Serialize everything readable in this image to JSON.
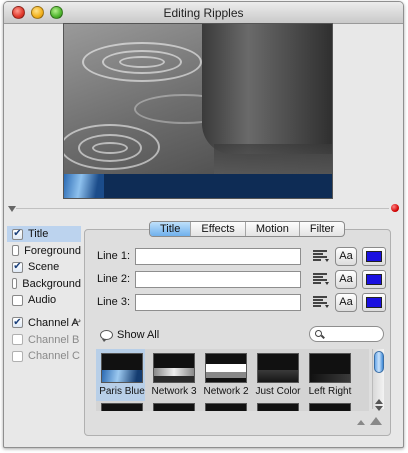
{
  "window": {
    "title": "Editing Ripples"
  },
  "sidebar": {
    "items": [
      {
        "label": "Title",
        "checked": true,
        "selected": true,
        "disabled": false
      },
      {
        "label": "Foreground",
        "checked": false,
        "selected": false,
        "disabled": false
      },
      {
        "label": "Scene",
        "checked": true,
        "selected": false,
        "disabled": false
      },
      {
        "label": "Background",
        "checked": false,
        "selected": false,
        "disabled": false
      },
      {
        "label": "Audio",
        "checked": false,
        "selected": false,
        "disabled": false
      }
    ],
    "channels": [
      {
        "label": "Channel A",
        "checked": true,
        "disabled": false
      },
      {
        "label": "Channel B",
        "checked": false,
        "disabled": true
      },
      {
        "label": "Channel C",
        "checked": false,
        "disabled": true
      }
    ]
  },
  "tabs": [
    {
      "label": "Title",
      "active": true
    },
    {
      "label": "Effects",
      "active": false
    },
    {
      "label": "Motion",
      "active": false
    },
    {
      "label": "Filter",
      "active": false
    }
  ],
  "lines": [
    {
      "label": "Line 1:",
      "value": "",
      "font_button": "Aa",
      "color": "#1a10e0"
    },
    {
      "label": "Line 2:",
      "value": "",
      "font_button": "Aa",
      "color": "#1a10e0"
    },
    {
      "label": "Line 3:",
      "value": "",
      "font_button": "Aa",
      "color": "#1a10e0"
    }
  ],
  "show_all": {
    "label": "Show All"
  },
  "search": {
    "value": ""
  },
  "templates": [
    {
      "name": "Paris Blue",
      "selected": true
    },
    {
      "name": "Network 3",
      "selected": false
    },
    {
      "name": "Network 2",
      "selected": false
    },
    {
      "name": "Just Color",
      "selected": false
    },
    {
      "name": "Left Right",
      "selected": false
    }
  ],
  "icons": {
    "disclosure": "disclosure-triangle-icon",
    "status": "red-status-dot-icon",
    "align": "align-text-icon",
    "show_all": "speech-bubble-icon",
    "search": "search-icon",
    "zoom_out": "small-mountain-icon",
    "zoom_in": "large-mountain-icon"
  }
}
